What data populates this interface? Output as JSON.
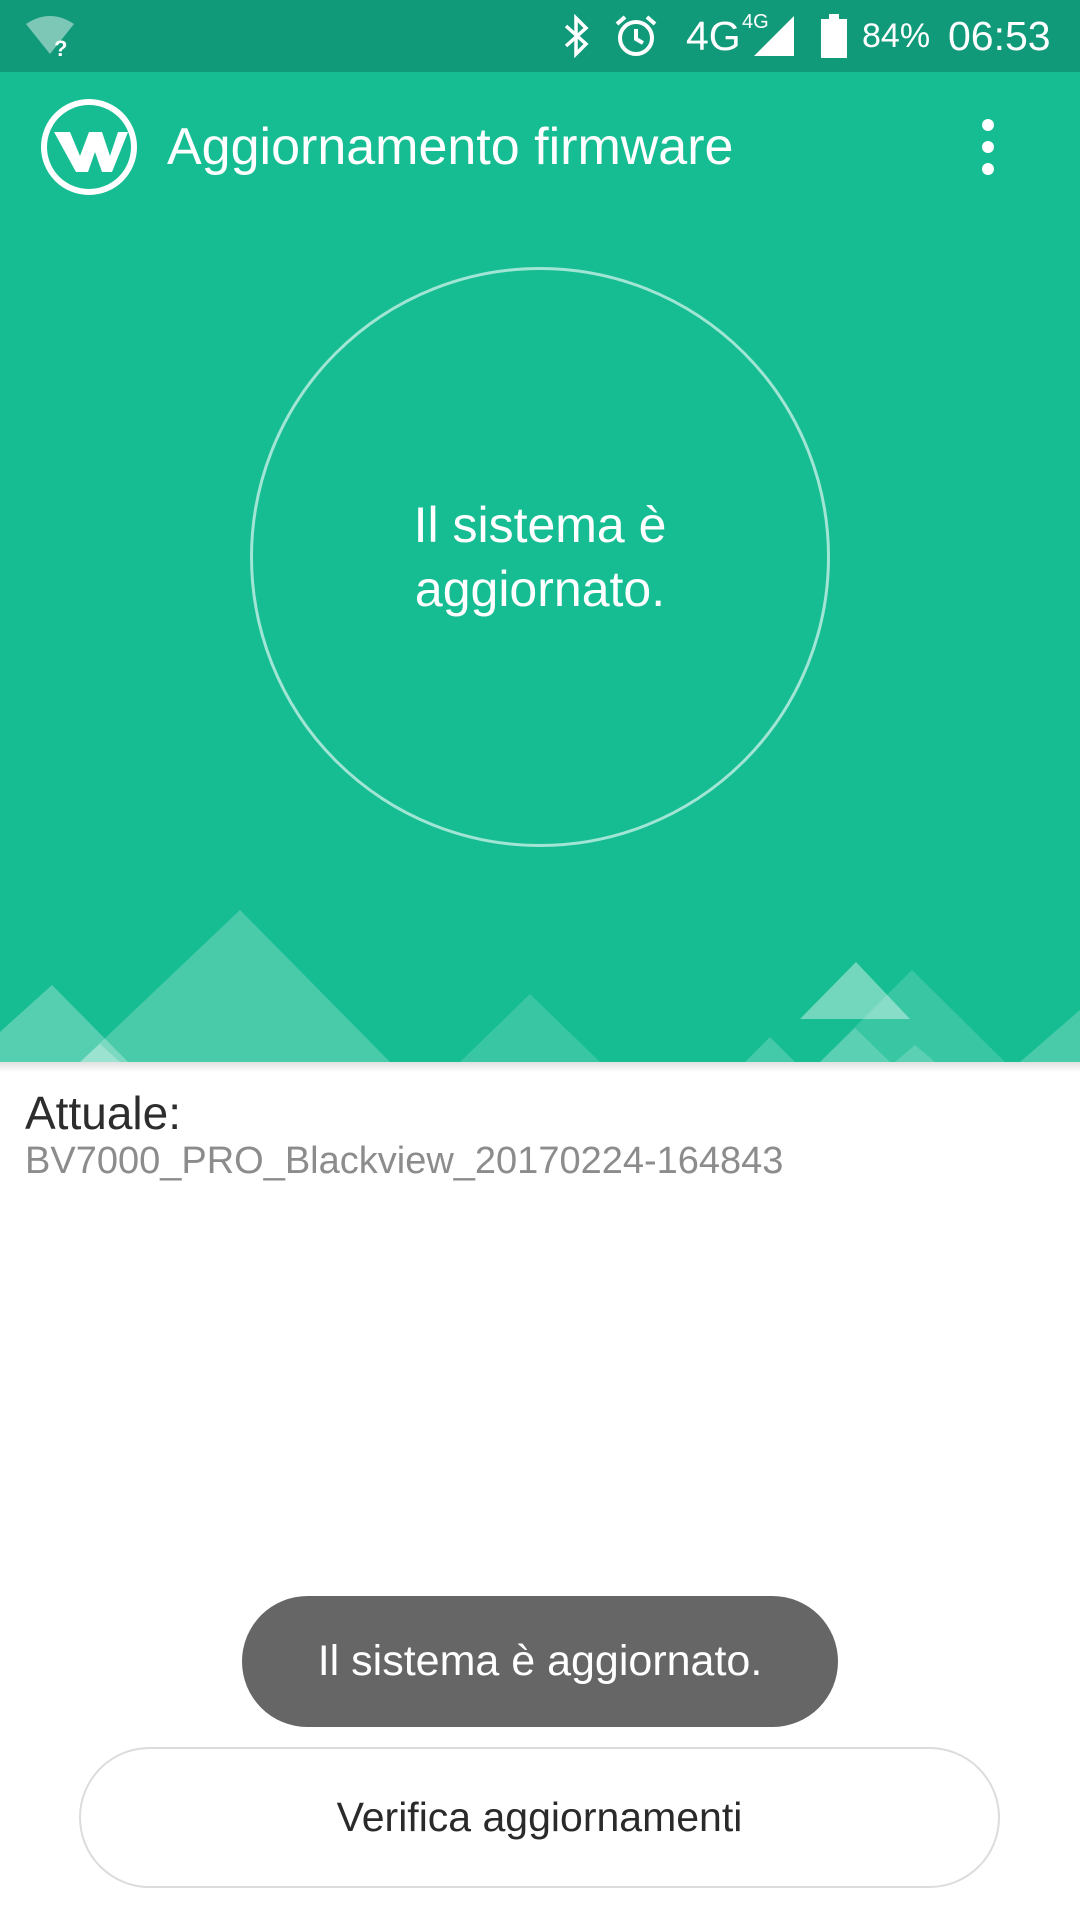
{
  "status_bar": {
    "network_type": "4G",
    "network_type_small": "4G",
    "battery_percent": "84%",
    "time": "06:53",
    "icons": [
      "wifi-unknown-icon",
      "bluetooth-icon",
      "alarm-icon",
      "signal-icon",
      "battery-icon"
    ]
  },
  "app_bar": {
    "title": "Aggiornamento firmware",
    "logo_icon": "app-logo-icon",
    "menu_icon": "more-vert-icon"
  },
  "status": {
    "message": "Il sistema è aggiornato."
  },
  "current": {
    "label": "Attuale:",
    "version": "BV7000_PRO_Blackview_20170224-164843"
  },
  "toast": {
    "message": "Il sistema è aggiornato."
  },
  "actions": {
    "check_updates_label": "Verifica aggiornamenti"
  },
  "colors": {
    "primary": "#16bd93",
    "status_bar": "#119a7a",
    "toast_bg": "#666666"
  }
}
